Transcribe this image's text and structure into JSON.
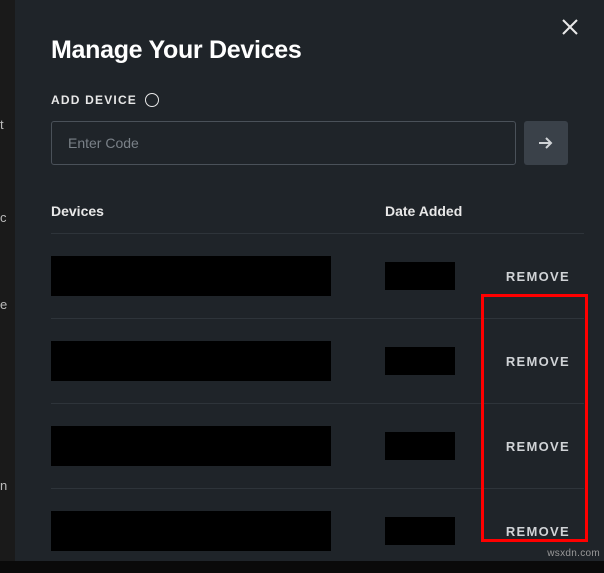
{
  "modal": {
    "title": "Manage Your Devices",
    "addDevice": {
      "label": "ADD DEVICE",
      "placeholder": "Enter Code"
    },
    "table": {
      "headers": {
        "devices": "Devices",
        "dateAdded": "Date Added"
      },
      "rows": [
        {
          "removeLabel": "REMOVE"
        },
        {
          "removeLabel": "REMOVE"
        },
        {
          "removeLabel": "REMOVE"
        },
        {
          "removeLabel": "REMOVE"
        }
      ]
    }
  },
  "watermark": "wsxdn.com"
}
